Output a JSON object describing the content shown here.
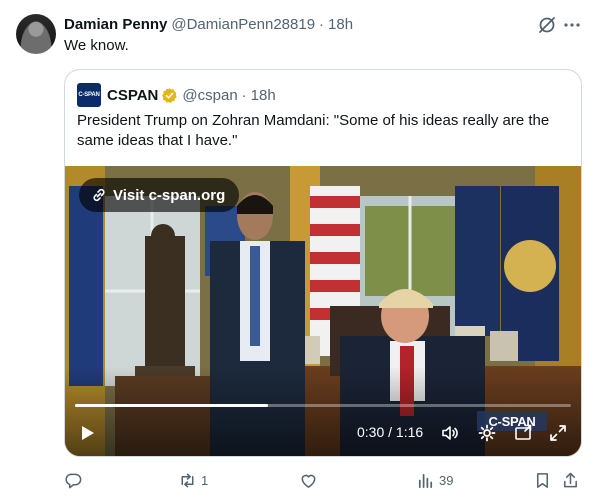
{
  "post": {
    "author_name": "Damian Penny",
    "author_handle": "@DamianPenn28819",
    "separator": "·",
    "time": "18h",
    "text": "We know."
  },
  "quote": {
    "avatar_text": "C-SPAN",
    "author_name": "CSPAN",
    "author_handle": "@cspan",
    "separator": "·",
    "time": "18h",
    "text": "President Trump on Zohran Mamdani: \"Some of his ideas really are the same ideas that I have.\""
  },
  "video": {
    "visit_label": "Visit c-span.org",
    "time_readout": "0:30 / 1:16",
    "progress": 0.39,
    "watermark": "C-SPAN"
  },
  "actions": {
    "reply_count": "",
    "repost_count": "1",
    "like_count": "",
    "views_count": "39"
  },
  "icons": {
    "grok": "grok-icon",
    "more": "more-icon",
    "verified": "verified-badge-icon",
    "link": "link-icon",
    "play": "play-icon",
    "volume": "volume-icon",
    "settings": "settings-icon",
    "pip": "pip-icon",
    "fullscreen": "fullscreen-icon",
    "reply": "reply-icon",
    "repost": "repost-icon",
    "like": "like-icon",
    "views": "views-icon",
    "bookmark": "bookmark-icon",
    "share": "share-icon"
  },
  "colors": {
    "text": "#0f1419",
    "secondary": "#536471",
    "border": "#cfd9de",
    "verified_gold": "#e2b719"
  }
}
